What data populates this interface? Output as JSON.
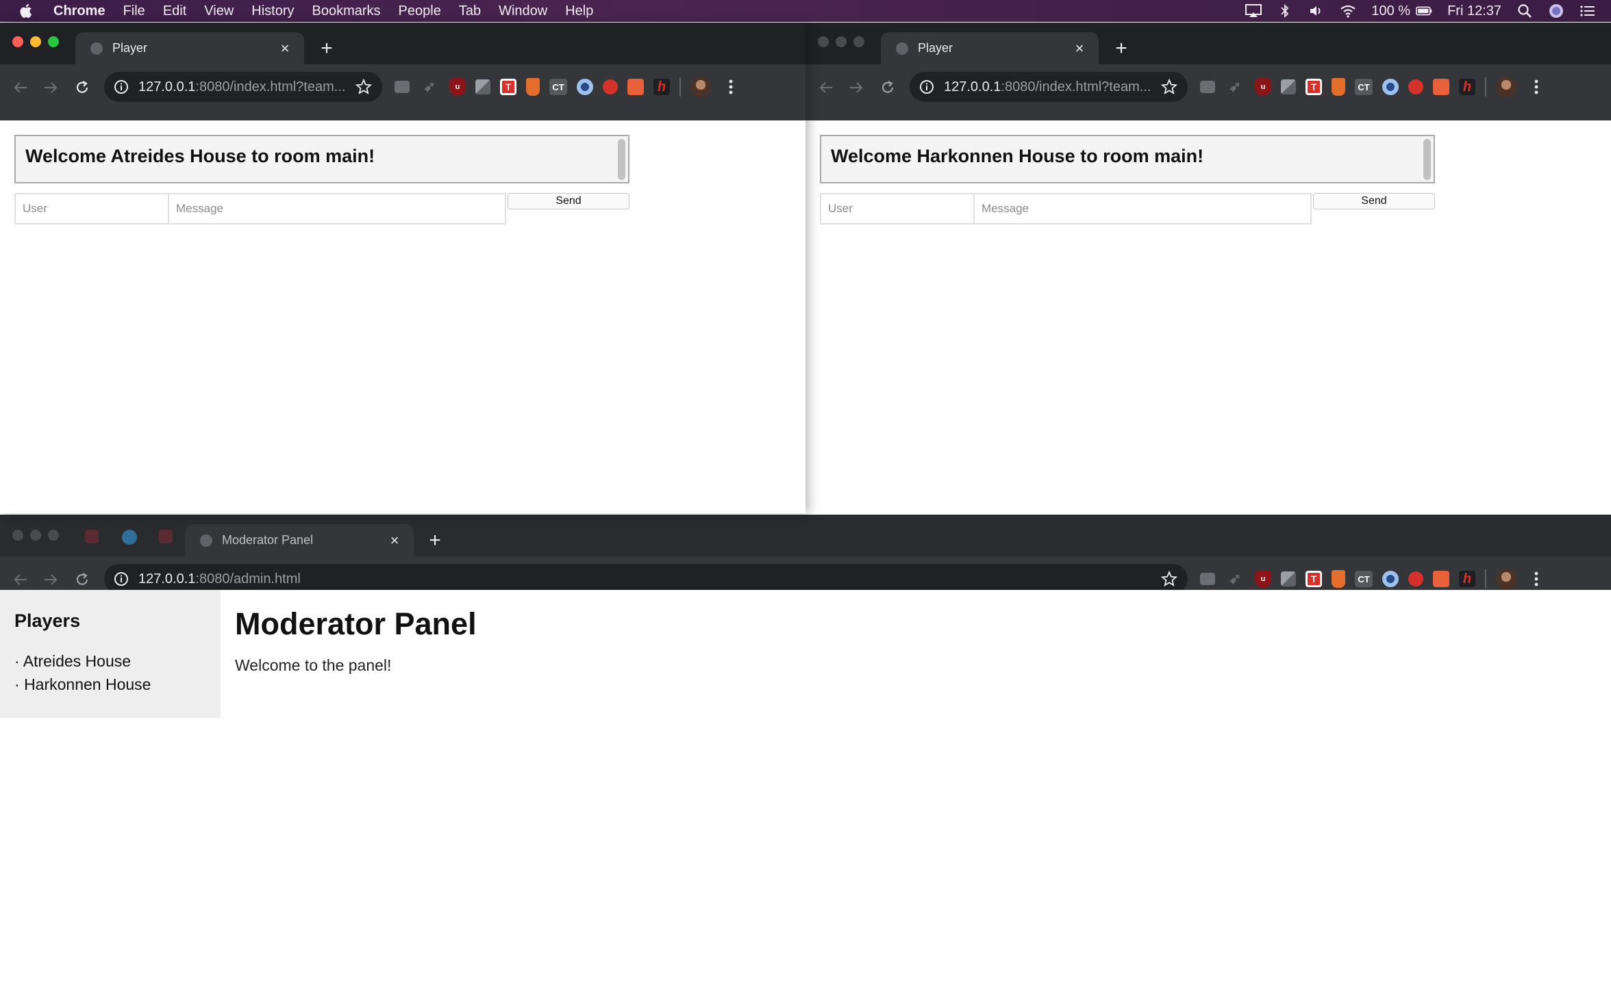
{
  "menubar": {
    "app": "Chrome",
    "items": [
      "File",
      "Edit",
      "View",
      "History",
      "Bookmarks",
      "People",
      "Tab",
      "Window",
      "Help"
    ],
    "battery": "100 %",
    "clock": "Fri 12:37",
    "icons": [
      "airplay-icon",
      "bluetooth-icon",
      "volume-icon",
      "wifi-icon",
      "battery-icon",
      "spotlight-icon",
      "siri-icon",
      "notification-center-icon"
    ]
  },
  "window_left": {
    "tab_title": "Player",
    "url_host": "127.0.0.1",
    "url_rest": ":8080/index.html?team...",
    "page": {
      "welcome": "Welcome Atreides House to room main!",
      "user_placeholder": "User",
      "message_placeholder": "Message",
      "send_label": "Send"
    }
  },
  "window_right": {
    "tab_title": "Player",
    "url_host": "127.0.0.1",
    "url_rest": ":8080/index.html?team...",
    "page": {
      "welcome": "Welcome Harkonnen House to room main!",
      "user_placeholder": "User",
      "message_placeholder": "Message",
      "send_label": "Send"
    }
  },
  "window_admin": {
    "tab_title": "Moderator Panel",
    "url_host": "127.0.0.1",
    "url_rest": ":8080/admin.html",
    "page": {
      "sidebar_title": "Players",
      "players": [
        "Atreides House",
        "Harkonnen House"
      ],
      "title": "Moderator Panel",
      "subtitle": "Welcome to the panel!"
    }
  },
  "extensions": [
    "briefcase-ext",
    "rocket-ext",
    "ublock-ext",
    "slash-ext",
    "t-ext",
    "cup-ext",
    "ct-ext",
    "circle-ext",
    "red-ball-ext",
    "calendar-ext",
    "h-ext"
  ],
  "ext_labels": {
    "t": "T",
    "ct": "CT",
    "h": "h"
  },
  "colors": {
    "tab_bg": "#35363a",
    "tabstrip_bg": "#202124",
    "close_dot": "#ff5f57",
    "min_dot": "#febc2e",
    "max_dot": "#28c840"
  }
}
